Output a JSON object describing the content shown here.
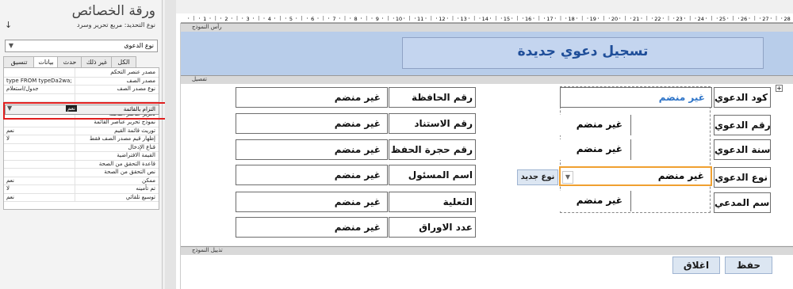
{
  "property_sheet": {
    "title": "ورقة الخصائص",
    "selection_type_label": "نوع التحديد:  مربع تحرير وسرد",
    "sort_icon": "sort-az-icon",
    "selected_object": "نوع الدعوى",
    "tabs": [
      "تنسيق",
      "بيانات",
      "حدث",
      "غير ذلك",
      "الكل"
    ],
    "selected_tab": "بيانات",
    "rows": [
      {
        "label": "مصدر عنصر التحكم",
        "value": ""
      },
      {
        "label": "مصدر الصف",
        "value": "type FROM typeDa2wa;"
      },
      {
        "label": "نوع مصدر الصف",
        "value": "جدول/استعلام"
      },
      {
        "label": "",
        "value": ""
      },
      {
        "label": "",
        "value": ""
      },
      {
        "label": "تحرير عناصر القائمة",
        "value": ""
      },
      {
        "label": "نموذج تحرير عناصر القائمة",
        "value": ""
      },
      {
        "label": "توريث قائمة القيم",
        "value": "نعم"
      },
      {
        "label": "إظهار قيم مصدر الصف فقط",
        "value": "لا"
      },
      {
        "label": "قناع الإدخال",
        "value": ""
      },
      {
        "label": "القيمة الافتراضية",
        "value": ""
      },
      {
        "label": "قاعدة التحقق من الصحة",
        "value": ""
      },
      {
        "label": "نص التحقق من الصحة",
        "value": ""
      },
      {
        "label": "ممكن",
        "value": "نعم"
      },
      {
        "label": "تم تأمينه",
        "value": "لا"
      },
      {
        "label": "توسيع تلقائي",
        "value": "نعم"
      }
    ],
    "highlighted_row": {
      "label": "التزام بالقائمة",
      "value": "نعم"
    }
  },
  "designer": {
    "ruler_numbers": [
      "1",
      "2",
      "3",
      "4",
      "5",
      "6",
      "7",
      "8",
      "9",
      "10",
      "11",
      "12",
      "13",
      "14",
      "15",
      "16",
      "17",
      "18",
      "19",
      "20",
      "21",
      "22",
      "23",
      "24",
      "25",
      "26",
      "27",
      "28"
    ],
    "bands": {
      "header": "رأس النموذج",
      "detail": "تفصيل",
      "footer": "تذييل النموذج"
    },
    "form_title": "تسجيل دعوي جديدة",
    "right_fields": [
      {
        "label": "كود الدعوي",
        "value": "غير منضم"
      },
      {
        "label": "رقم الدعوي",
        "value": "غير منضم"
      },
      {
        "label": "سنة الدعوي",
        "value": "غير منضم"
      },
      {
        "label": "نوع الدعوي",
        "value": "غير منضم"
      },
      {
        "label": "اسم المدعي",
        "value": "غير منضم"
      }
    ],
    "left_fields": [
      {
        "label": "رقم الحافظة",
        "value": "غير منضم"
      },
      {
        "label": "رقم الاستناد",
        "value": "غير منضم"
      },
      {
        "label": "رقم حجرة الحفظ",
        "value": "غير منضم"
      },
      {
        "label": "اسم المسئول",
        "value": "غير منضم"
      },
      {
        "label": "التعلية",
        "value": "غير منضم"
      },
      {
        "label": "عدد الاوراق",
        "value": "غير منضم"
      }
    ],
    "new_type_button": "نوع جديد",
    "save_button": "حفظ",
    "close_button": "اغلاق",
    "colors": {
      "header_band": "#b8cdea",
      "title": "#1f4e99",
      "highlight": "#e01e1e",
      "combo_focus": "#f0a030",
      "code_value": "#2e74c8"
    }
  }
}
